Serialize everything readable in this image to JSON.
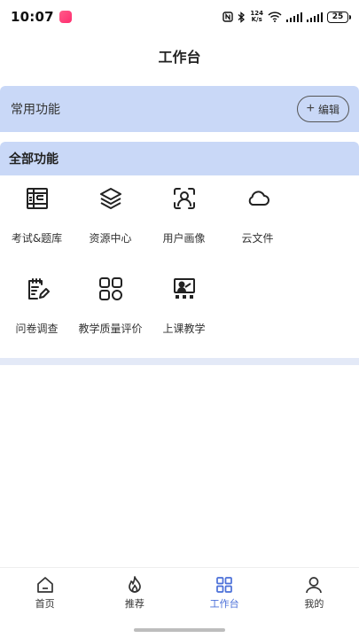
{
  "status_bar": {
    "time": "10:07",
    "network_speed_value": "124",
    "network_speed_unit": "K/s",
    "battery": "25"
  },
  "header": {
    "title": "工作台"
  },
  "frequent": {
    "title": "常用功能",
    "edit_label": "编辑"
  },
  "all_functions": {
    "title": "全部功能",
    "items": [
      {
        "label": "考试&题库",
        "icon": "exam-bank-icon"
      },
      {
        "label": "资源中心",
        "icon": "layers-icon"
      },
      {
        "label": "用户画像",
        "icon": "face-scan-icon"
      },
      {
        "label": "云文件",
        "icon": "cloud-icon"
      },
      {
        "label": "问卷调查",
        "icon": "survey-clipboard-icon"
      },
      {
        "label": "教学质量评价",
        "icon": "grid-apps-icon"
      },
      {
        "label": "上课教学",
        "icon": "teaching-board-icon"
      }
    ]
  },
  "bottom_nav": {
    "items": [
      {
        "label": "首页",
        "icon": "home-icon"
      },
      {
        "label": "推荐",
        "icon": "flame-icon"
      },
      {
        "label": "工作台",
        "icon": "workbench-grid-icon",
        "active": true
      },
      {
        "label": "我的",
        "icon": "user-icon"
      }
    ]
  },
  "colors": {
    "section_bg": "#c9d8f7",
    "accent": "#4a6fd8"
  }
}
